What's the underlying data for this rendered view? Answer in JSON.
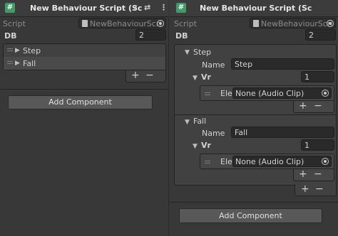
{
  "left": {
    "header_title": "New Behaviour Script (Sc",
    "script_label": "Script",
    "script_value": "NewBehaviourScri",
    "db_label": "DB",
    "db_value": "2",
    "items": [
      "Step",
      "Fall"
    ],
    "plus": "+",
    "minus": "−",
    "add_component": "Add Component"
  },
  "right": {
    "header_title": "New Behaviour Script (Sc",
    "script_label": "Script",
    "script_value": "NewBehaviourScri",
    "db_label": "DB",
    "db_value": "2",
    "elements": [
      {
        "title": "Step",
        "name_label": "Name",
        "name_value": "Step",
        "vr_label": "Vr",
        "vr_value": "1",
        "ele_label": "Ele",
        "ele_value": "None (Audio Clip)"
      },
      {
        "title": "Fall",
        "name_label": "Name",
        "name_value": "Fall",
        "vr_label": "Vr",
        "vr_value": "1",
        "ele_label": "Ele",
        "ele_value": "None (Audio Clip)"
      }
    ],
    "plus": "+",
    "minus": "−",
    "add_component": "Add Component"
  },
  "icons": {
    "cs": "#",
    "help": "?",
    "settings": "⇄",
    "menu": "⋮"
  }
}
